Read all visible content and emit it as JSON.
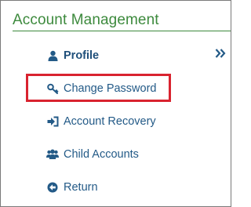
{
  "header": {
    "title": "Account Management"
  },
  "nav": {
    "items": [
      {
        "label": "Profile",
        "icon": "user-icon",
        "active": true
      },
      {
        "label": "Change Password",
        "icon": "key-icon",
        "active": false
      },
      {
        "label": "Account Recovery",
        "icon": "sign-in-icon",
        "active": false
      },
      {
        "label": "Child Accounts",
        "icon": "users-icon",
        "active": false
      },
      {
        "label": "Return",
        "icon": "arrow-circle-left-icon",
        "active": false
      }
    ],
    "collapse_icon": "double-chevron-right-icon"
  },
  "colors": {
    "title": "#3d8a3d",
    "link": "#235a87",
    "highlight": "#d9232f"
  }
}
